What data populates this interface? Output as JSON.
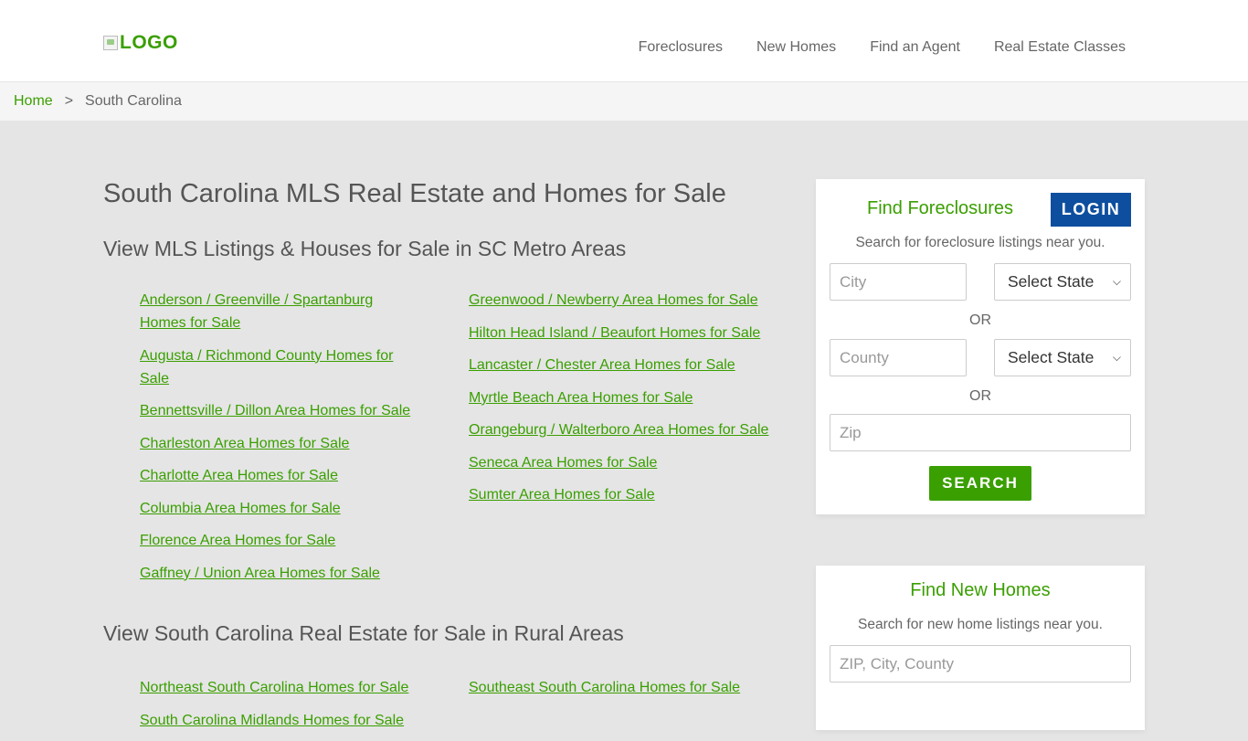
{
  "header": {
    "logo_text": "LOGO",
    "nav": [
      "Foreclosures",
      "New Homes",
      "Find an Agent",
      "Real Estate Classes"
    ]
  },
  "breadcrumb": {
    "home": "Home",
    "separator": ">",
    "current": "South Carolina"
  },
  "main": {
    "title": "South Carolina MLS Real Estate and Homes for Sale",
    "metro": {
      "heading": "View MLS Listings & Houses for Sale in SC Metro Areas",
      "left": [
        "Anderson / Greenville / Spartanburg Homes for Sale",
        "Augusta / Richmond County Homes for Sale",
        "Bennettsville / Dillon Area Homes for Sale",
        "Charleston Area Homes for Sale",
        "Charlotte Area Homes for Sale",
        "Columbia Area Homes for Sale",
        "Florence Area Homes for Sale",
        "Gaffney / Union Area Homes for Sale"
      ],
      "right": [
        "Greenwood / Newberry Area Homes for Sale",
        "Hilton Head Island / Beaufort Homes for Sale",
        "Lancaster / Chester Area Homes for Sale",
        "Myrtle Beach Area Homes for Sale",
        "Orangeburg / Walterboro Area Homes for Sale",
        "Seneca Area Homes for Sale",
        "Sumter Area Homes for Sale"
      ]
    },
    "rural": {
      "heading": "View South Carolina Real Estate for Sale in Rural Areas",
      "left": [
        "Northeast South Carolina Homes for Sale",
        "South Carolina Midlands Homes for Sale"
      ],
      "right": [
        "Southeast South Carolina Homes for Sale"
      ]
    }
  },
  "foreclosures_card": {
    "title": "Find Foreclosures",
    "login": "LOGIN",
    "subtitle": "Search for foreclosure listings near you.",
    "city_placeholder": "City",
    "state_select_1": "Select State",
    "or_1": "OR",
    "county_placeholder": "County",
    "state_select_2": "Select State",
    "or_2": "OR",
    "zip_placeholder": "Zip",
    "search": "SEARCH"
  },
  "new_homes_card": {
    "title": "Find New Homes",
    "subtitle": "Search for new home listings near you.",
    "location_placeholder": "ZIP, City, County"
  },
  "colors": {
    "accent_green": "#3a9f00",
    "login_blue": "#0d4f9e",
    "page_bg": "#e5e5e5"
  }
}
